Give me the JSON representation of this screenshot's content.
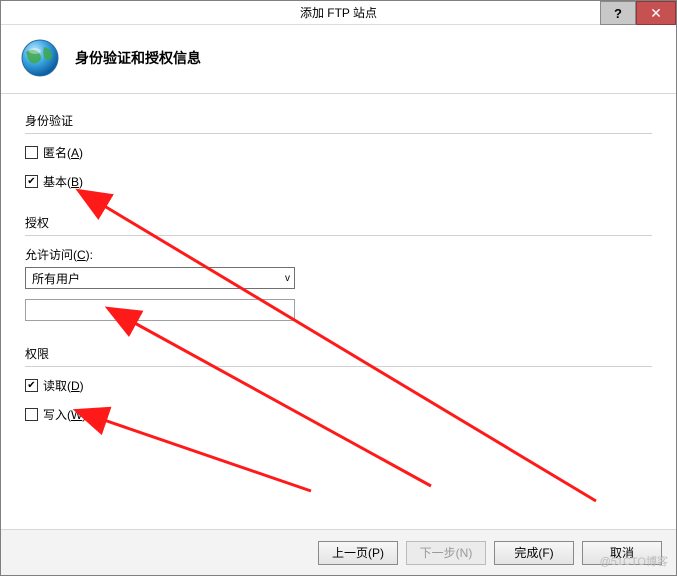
{
  "window": {
    "title": "添加 FTP 站点",
    "help": "?",
    "close": "✕"
  },
  "header": {
    "title": "身份验证和授权信息"
  },
  "auth": {
    "section_title": "身份验证",
    "anonymous_label": "匿名(",
    "anonymous_key": "A",
    "anonymous_suffix": ")",
    "anonymous_checked": false,
    "basic_label": "基本(",
    "basic_key": "B",
    "basic_suffix": ")",
    "basic_checked": true
  },
  "authorization": {
    "section_title": "授权",
    "allow_access_label": "允许访问(",
    "allow_access_key": "C",
    "allow_access_suffix": "):",
    "selected_option": "所有用户",
    "textbox_value": ""
  },
  "permissions": {
    "section_title": "权限",
    "read_label": "读取(",
    "read_key": "D",
    "read_suffix": ")",
    "read_checked": true,
    "write_label": "写入(",
    "write_key": "W",
    "write_suffix": ")",
    "write_checked": false
  },
  "footer": {
    "prev": "上一页(P)",
    "next": "下一步(N)",
    "finish": "完成(F)",
    "cancel": "取消"
  },
  "watermark": "@51CTO博客"
}
